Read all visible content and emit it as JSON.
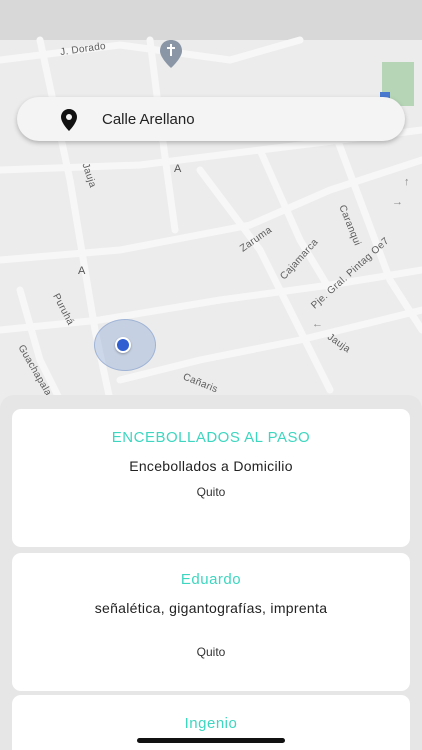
{
  "map": {
    "streets": [
      "J. Dorado",
      "Jauja",
      "Zaruma",
      "Cajamarca",
      "Caranqui",
      "Pje. Gral. Pintag Oe7",
      "Puruhá",
      "Guachapala",
      "Cañaris",
      "Jauja"
    ],
    "letters": [
      "A",
      "A"
    ],
    "icons": [
      "church-icon",
      "location-dot-icon",
      "one-way-arrow-icon"
    ]
  },
  "search": {
    "icon": "map-pin-icon",
    "value": "Calle Arellano"
  },
  "results": [
    {
      "title": "ENCEBOLLADOS AL PASO",
      "subtitle": "Encebollados a Domicilio",
      "city": "Quito"
    },
    {
      "title": "Eduardo",
      "subtitle": "señalética, gigantografías, imprenta",
      "city": "Quito"
    },
    {
      "title": "Ingenio",
      "subtitle": "",
      "city": ""
    }
  ],
  "colors": {
    "accent": "#3dd6c0",
    "location_dot": "#2f5fd0",
    "sheet_bg": "#e6e6e6"
  }
}
